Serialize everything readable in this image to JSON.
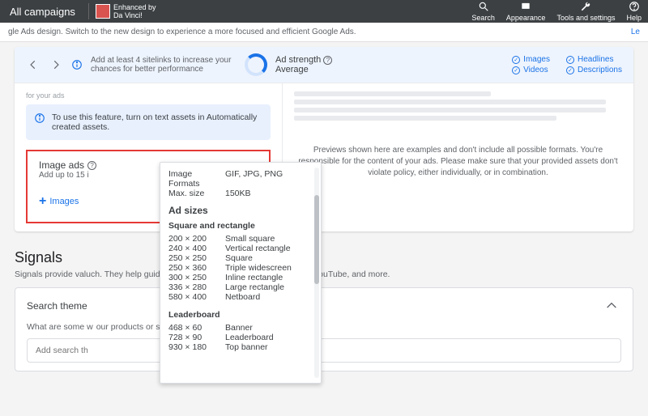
{
  "topbar": {
    "title": "All campaigns",
    "enhanced_line1": "Enhanced by",
    "enhanced_line2": "Da Vinci!",
    "actions": {
      "search": "Search",
      "appearance": "Appearance",
      "tools": "Tools and settings",
      "help": "Help"
    }
  },
  "banner": {
    "text": "gle Ads design. Switch to the new design to experience a more focused and efficient Google Ads.",
    "link": "Le"
  },
  "strength": {
    "tip": "Add at least 4 sitelinks to increase your chances for better performance",
    "label": "Ad strength",
    "value": "Average",
    "checks": {
      "images": "Images",
      "headlines": "Headlines",
      "videos": "Videos",
      "descriptions": "Descriptions"
    }
  },
  "left": {
    "truncated": "for your ads",
    "info": "To use this feature, turn on text assets in Automatically created assets."
  },
  "image_ads": {
    "title": "Image ads",
    "subtitle": "Add up to 15 i",
    "add_label": "Images"
  },
  "preview": {
    "note": "Previews shown here are examples and don't include all possible formats. You're responsible for the content of your ads. Please make sure that your provided assets don't violate policy, either individually, or in combination."
  },
  "signals": {
    "heading": "Signals",
    "subtitle_left": "Signals provide valu",
    "subtitle_right": "ch. They help guide who sees your ads on Google Search, YouTube, and more.",
    "themes_label": "Search theme",
    "question_left": "What are some w",
    "question_right": "our products or services?",
    "placeholder": "Add search th"
  },
  "popover": {
    "fmt_label": "Image Formats",
    "fmt_value": "GIF, JPG, PNG",
    "max_label": "Max. size",
    "max_value": "150KB",
    "heading": "Ad sizes",
    "sec1": "Square and rectangle",
    "sec1_rows": [
      {
        "k": "200 × 200",
        "v": "Small square"
      },
      {
        "k": "240 × 400",
        "v": "Vertical rectangle"
      },
      {
        "k": "250 × 250",
        "v": "Square"
      },
      {
        "k": "250 × 360",
        "v": "Triple widescreen"
      },
      {
        "k": "300 × 250",
        "v": "Inline rectangle"
      },
      {
        "k": "336 × 280",
        "v": "Large rectangle"
      },
      {
        "k": "580 × 400",
        "v": "Netboard"
      }
    ],
    "sec2": "Leaderboard",
    "sec2_rows": [
      {
        "k": "468 × 60",
        "v": "Banner"
      },
      {
        "k": "728 × 90",
        "v": "Leaderboard"
      },
      {
        "k": "930 × 180",
        "v": "Top banner"
      }
    ]
  }
}
